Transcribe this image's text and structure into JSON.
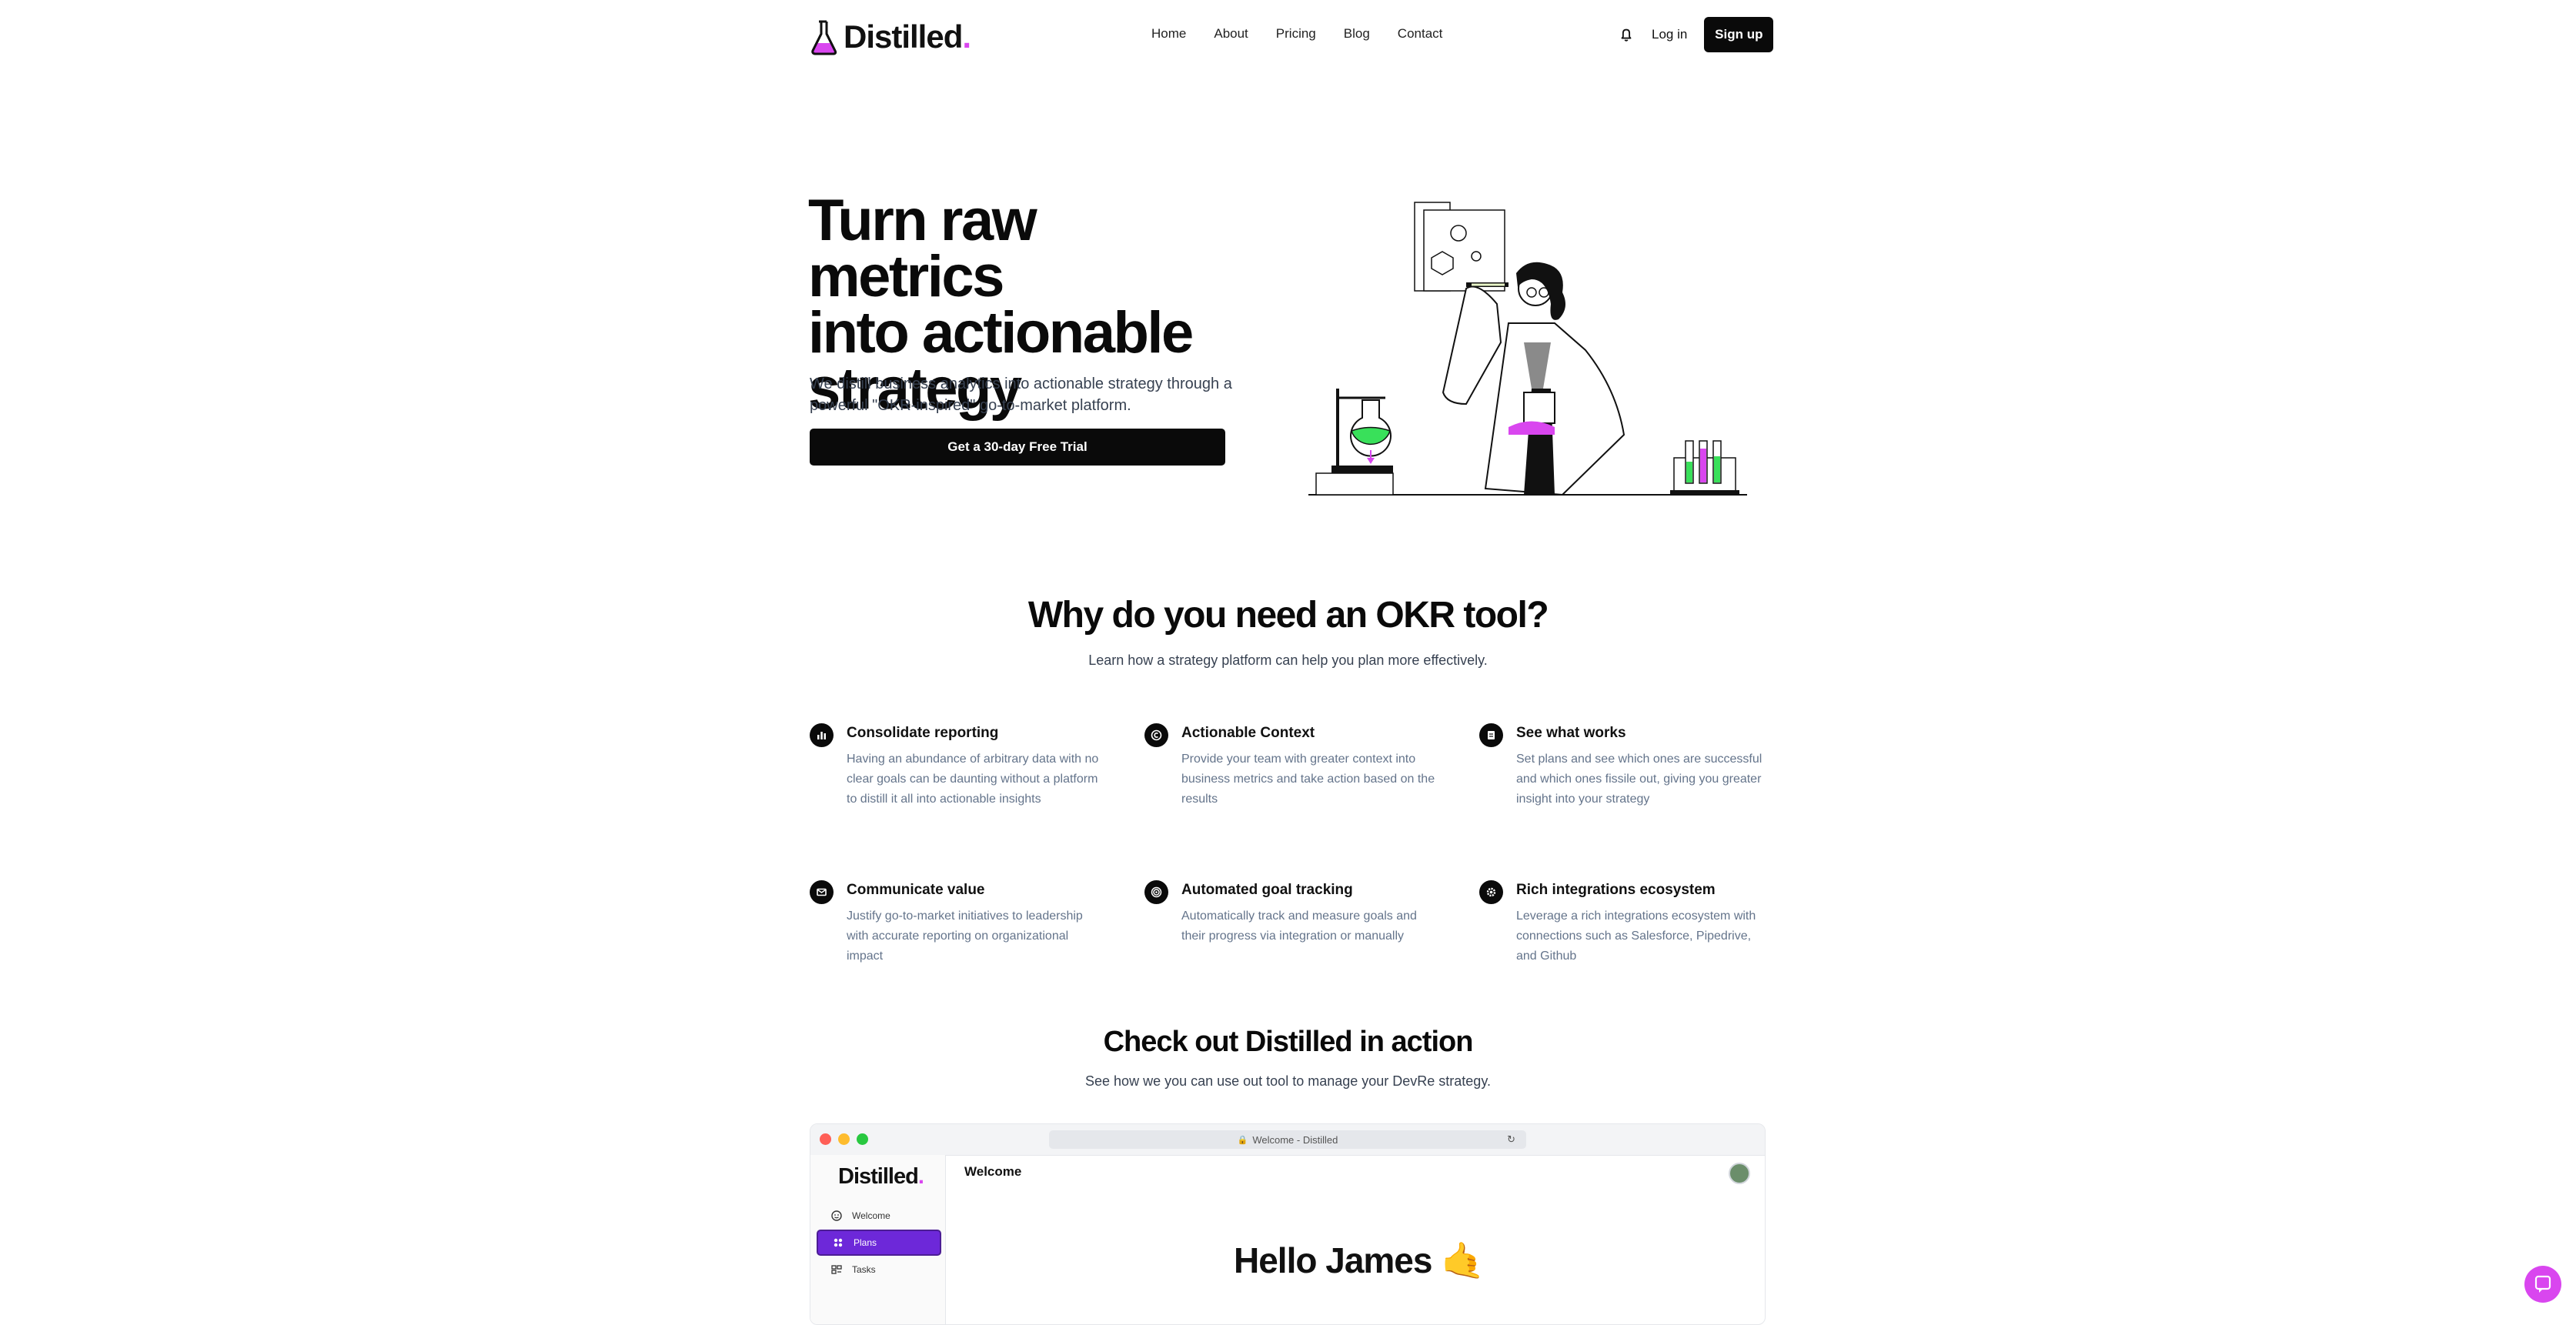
{
  "nav": {
    "logo": "Distilled",
    "logo_dot": ".",
    "links": [
      "Home",
      "About",
      "Pricing",
      "Blog",
      "Contact"
    ],
    "login": "Log in",
    "signup": "Sign up"
  },
  "hero": {
    "title_lines": [
      "Turn raw metrics",
      "into actionable",
      "strategy"
    ],
    "subtitle": "We distill business analytics into actionable strategy through a powerful \"OKR-inspired\" go-to-market platform.",
    "cta": "Get a 30-day Free Trial"
  },
  "why": {
    "title": "Why do you need an OKR tool?",
    "subtitle": "Learn how a strategy platform can help you plan more effectively.",
    "features": [
      {
        "icon": "bar-chart-icon",
        "title": "Consolidate reporting",
        "desc": "Having an abundance of arbitrary data with no clear goals can be daunting without a platform to distill it all into actionable insights"
      },
      {
        "icon": "copyright-icon",
        "title": "Actionable Context",
        "desc": "Provide your team with greater context into business metrics and take action based on the results"
      },
      {
        "icon": "document-icon",
        "title": "See what works",
        "desc": "Set plans and see which ones are successful and which ones fissile out, giving you greater insight into your strategy"
      },
      {
        "icon": "mail-icon",
        "title": "Communicate value",
        "desc": "Justify go-to-market initiatives to leadership with accurate reporting on organizational impact"
      },
      {
        "icon": "target-icon",
        "title": "Automated goal tracking",
        "desc": "Automatically track and measure goals and their progress via integration or manually"
      },
      {
        "icon": "gear-icon",
        "title": "Rich integrations ecosystem",
        "desc": "Leverage a rich integrations ecosystem with connections such as Salesforce, Pipedrive, and Github"
      }
    ]
  },
  "action": {
    "title": "Check out Distilled in action",
    "subtitle": "See how we you can use out tool to manage your DevRe strategy."
  },
  "mock": {
    "url": "Welcome - Distilled",
    "logo": "Distilled",
    "logo_dot": ".",
    "sidebar": [
      "Welcome",
      "Plans",
      "Tasks"
    ],
    "active_item": "Plans",
    "header": "Welcome",
    "greeting": "Hello James 🤙"
  },
  "colors": {
    "accent": "#d946ef",
    "primary": "#0a0a0a",
    "active_nav": "#6d28d9"
  }
}
